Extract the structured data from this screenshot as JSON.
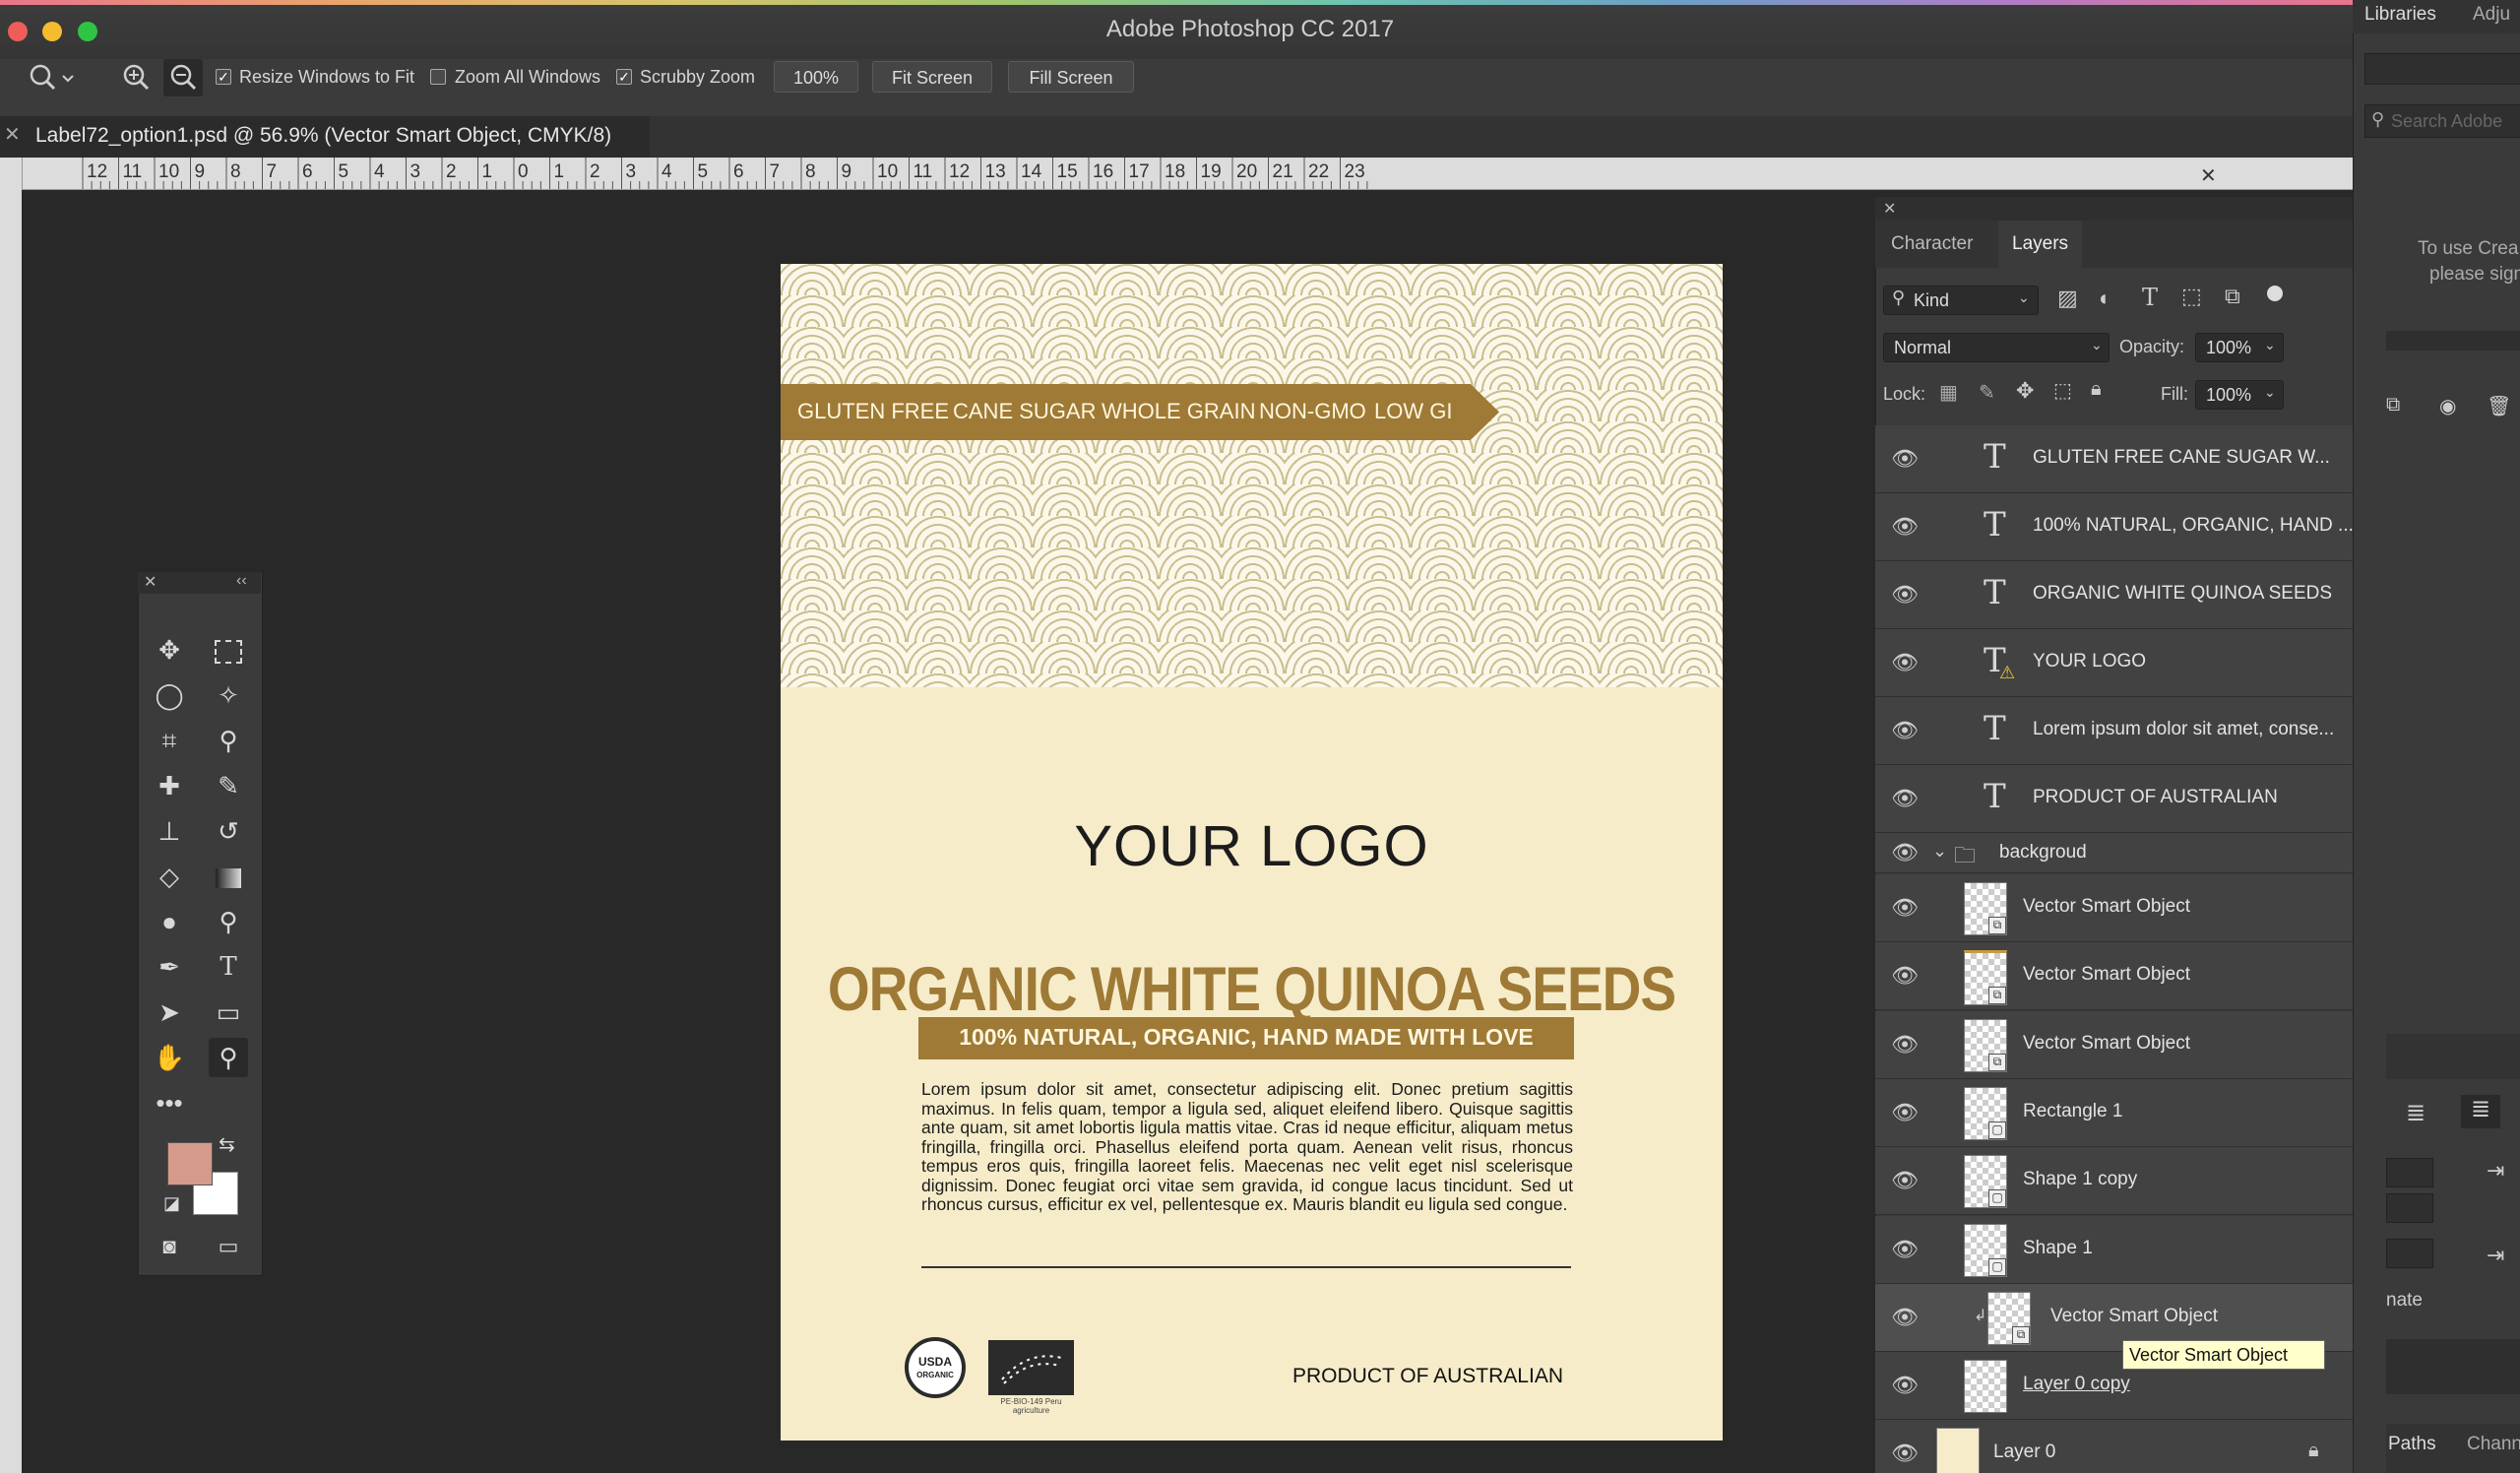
{
  "window": {
    "title": "Adobe Photoshop CC 2017"
  },
  "options_bar": {
    "resize_windows_label": "Resize Windows to Fit",
    "zoom_all_label": "Zoom All Windows",
    "scrubby_zoom_label": "Scrubby Zoom",
    "zoom_value": "100%",
    "fit_screen": "Fit Screen",
    "fill_screen": "Fill Screen"
  },
  "document_tab": {
    "label": "Label72_option1.psd @ 56.9% (Vector Smart Object, CMYK/8)"
  },
  "ruler": {
    "labels": [
      "12",
      "11",
      "10",
      "9",
      "8",
      "7",
      "6",
      "5",
      "4",
      "3",
      "2",
      "1",
      "0",
      "1",
      "2",
      "3",
      "4",
      "5",
      "6",
      "7",
      "8",
      "9",
      "10",
      "11",
      "12",
      "13",
      "14",
      "15",
      "16",
      "17",
      "18",
      "19",
      "20",
      "21",
      "22",
      "23"
    ]
  },
  "artboard": {
    "banner_items": [
      "GLUTEN FREE",
      "CANE SUGAR",
      "WHOLE GRAIN",
      "NON-GMO",
      "LOW GI"
    ],
    "logo": "YOUR LOGO",
    "product_title": "ORGANIC WHITE QUINOA SEEDS",
    "product_subtitle": "100% NATURAL, ORGANIC, HAND MADE WITH LOVE",
    "body_text": "Lorem ipsum dolor sit amet, consectetur adipiscing elit. Donec pretium sagittis maximus. In felis quam, tempor a ligula sed, aliquet eleifend libero. Quisque sagittis ante quam, sit amet lobortis ligula mattis vitae. Cras id neque efficitur, aliquam metus fringilla, fringilla orci. Phasellus eleifend porta quam. Aenean velit risus, rhoncus tempus eros quis, fringilla laoreet felis. Maecenas nec velit eget nisl scelerisque dignissim. Donec feugiat orci vitae sem gravida, id congue lacus tincidunt. Sed ut rhoncus cursus, efficitur ex vel, pellentesque ex. Mauris blandit eu ligula sed congue.",
    "usda_line1": "USDA",
    "usda_line2": "ORGANIC",
    "eu_caption": "PE-BIO-149 Peru agriculture",
    "product_of": "PRODUCT OF AUSTRALIAN"
  },
  "colors": {
    "label_gold": "#9e7a36",
    "label_cream": "#f6ecc9",
    "foreground_swatch": "#d59a8a",
    "background_swatch": "#ffffff"
  },
  "panel": {
    "tabs": [
      "Character",
      "Layers"
    ],
    "active_tab": "Layers",
    "filter_kind": "Kind",
    "blend_mode": "Normal",
    "opacity_label": "Opacity:",
    "opacity_value": "100%",
    "lock_label": "Lock:",
    "fill_label": "Fill:",
    "fill_value": "100%",
    "group_name": "backgroud",
    "layers": [
      {
        "name": "GLUTEN FREE   CANE SUGAR   W...",
        "kind": "text"
      },
      {
        "name": "100% NATURAL, ORGANIC, HAND ...",
        "kind": "text"
      },
      {
        "name": "ORGANIC WHITE QUINOA SEEDS",
        "kind": "text"
      },
      {
        "name": "YOUR LOGO",
        "kind": "text-warning"
      },
      {
        "name": "Lorem ipsum dolor sit amet, conse...",
        "kind": "text"
      },
      {
        "name": "PRODUCT OF AUSTRALIAN",
        "kind": "text"
      }
    ],
    "group_layers": [
      {
        "name": "Vector Smart Object"
      },
      {
        "name": "Vector Smart Object"
      },
      {
        "name": "Vector Smart Object"
      },
      {
        "name": "Rectangle 1"
      },
      {
        "name": "Shape 1 copy"
      },
      {
        "name": "Shape 1"
      },
      {
        "name": "Vector Smart Object"
      },
      {
        "name": "Layer 0 copy"
      },
      {
        "name": "Layer 0"
      }
    ],
    "tooltip": "Vector Smart Object"
  },
  "right_strip": {
    "tab_libraries": "Libraries",
    "tab_adjust": "Adju",
    "search_placeholder": "Search Adobe",
    "note_line1": "To use Crea",
    "note_line2": "please sign",
    "truncated_word": "nate",
    "tab_paths": "Paths",
    "tab_channels": "Chann"
  }
}
